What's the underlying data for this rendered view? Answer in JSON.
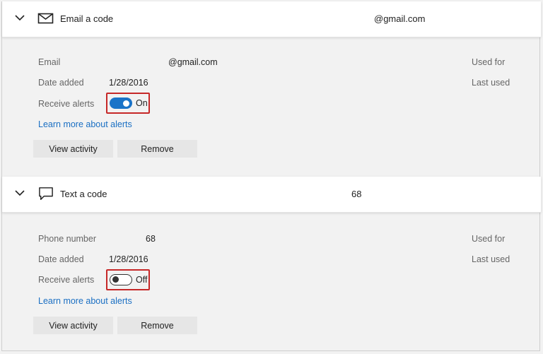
{
  "colors": {
    "accent": "#1a73c8",
    "highlight": "#c62828",
    "link": "#1a6fc3"
  },
  "methods": [
    {
      "icon": "envelope-icon",
      "title": "Email a code",
      "header_value": "@gmail.com",
      "field1_label": "Email",
      "field1_value": "@gmail.com",
      "date_label": "Date added",
      "date_value": "1/28/2016",
      "alerts_label": "Receive alerts",
      "alerts_state": "On",
      "learn_more": "Learn more about alerts",
      "used_for": "Used for",
      "last_used": "Last used",
      "view_activity": "View activity",
      "remove": "Remove"
    },
    {
      "icon": "chat-bubble-icon",
      "title": "Text a code",
      "header_value": "68",
      "field1_label": "Phone number",
      "field1_value": "68",
      "date_label": "Date added",
      "date_value": "1/28/2016",
      "alerts_label": "Receive alerts",
      "alerts_state": "Off",
      "learn_more": "Learn more about alerts",
      "used_for": "Used for",
      "last_used": "Last used",
      "view_activity": "View activity",
      "remove": "Remove"
    }
  ]
}
